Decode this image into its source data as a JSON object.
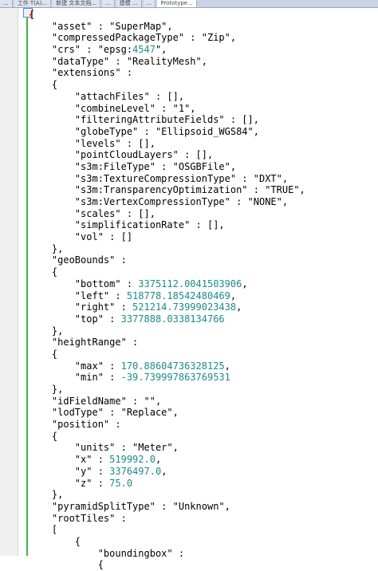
{
  "tabs": [
    {
      "label": "..."
    },
    {
      "label": "工作 T(A)..."
    },
    {
      "label": "新建 文本文档..."
    },
    {
      "label": "..."
    },
    {
      "label": "建模 ..."
    },
    {
      "label": "..."
    },
    {
      "label": "Prototype..."
    }
  ],
  "editor": {
    "lines": [
      {
        "t": "{",
        "kind": "open"
      },
      {
        "t": "    \"asset\" : \"SuperMap\","
      },
      {
        "t": "    \"compressedPackageType\" : \"Zip\","
      },
      {
        "t": "    \"crs\" : \"epsg:",
        "n": "4547",
        "t2": "\","
      },
      {
        "t": "    \"dataType\" : \"RealityMesh\","
      },
      {
        "t": "    \"extensions\" :"
      },
      {
        "t": "    {"
      },
      {
        "t": "        \"attachFiles\" : [],"
      },
      {
        "t": "        \"combineLevel\" : \"1\","
      },
      {
        "t": "        \"filteringAttributeFields\" : [],"
      },
      {
        "t": "        \"globeType\" : \"Ellipsoid_WGS84\","
      },
      {
        "t": "        \"levels\" : [],"
      },
      {
        "t": "        \"pointCloudLayers\" : [],"
      },
      {
        "t": "        \"s3m:FileType\" : \"OSGBFile\","
      },
      {
        "t": "        \"s3m:TextureCompressionType\" : \"DXT\","
      },
      {
        "t": "        \"s3m:TransparencyOptimization\" : \"TRUE\","
      },
      {
        "t": "        \"s3m:VertexCompressionType\" : \"NONE\","
      },
      {
        "t": "        \"scales\" : [],"
      },
      {
        "t": "        \"simplificationRate\" : [],"
      },
      {
        "t": "        \"vol\" : []"
      },
      {
        "t": "    },"
      },
      {
        "t": "    \"geoBounds\" :"
      },
      {
        "t": "    {"
      },
      {
        "t": "        \"bottom\" : ",
        "n": "3375112.0041503906",
        "t2": ","
      },
      {
        "t": "        \"left\" : ",
        "n": "518778.18542480469",
        "t2": ","
      },
      {
        "t": "        \"right\" : ",
        "n": "521214.73999023438",
        "t2": ","
      },
      {
        "t": "        \"top\" : ",
        "n": "3377888.0338134766",
        "t2": ""
      },
      {
        "t": "    },"
      },
      {
        "t": "    \"heightRange\" :"
      },
      {
        "t": "    {"
      },
      {
        "t": "        \"max\" : ",
        "n": "170.88604736328125",
        "t2": ","
      },
      {
        "t": "        \"min\" : ",
        "n": "-39.739997863769531",
        "t2": ""
      },
      {
        "t": "    },"
      },
      {
        "t": "    \"idFieldName\" : \"\","
      },
      {
        "t": "    \"lodType\" : \"Replace\","
      },
      {
        "t": "    \"position\" :"
      },
      {
        "t": "    {"
      },
      {
        "t": "        \"units\" : \"Meter\","
      },
      {
        "t": "        \"x\" : ",
        "n": "519992.0",
        "t2": ","
      },
      {
        "t": "        \"y\" : ",
        "n": "3376497.0",
        "t2": ","
      },
      {
        "t": "        \"z\" : ",
        "n": "75.0",
        "t2": ""
      },
      {
        "t": "    },"
      },
      {
        "t": "    \"pyramidSplitType\" : \"Unknown\","
      },
      {
        "t": "    \"rootTiles\" :"
      },
      {
        "t": "    ["
      },
      {
        "t": "        {"
      },
      {
        "t": "            \"boundingbox\" :"
      },
      {
        "t": "            {"
      }
    ]
  }
}
